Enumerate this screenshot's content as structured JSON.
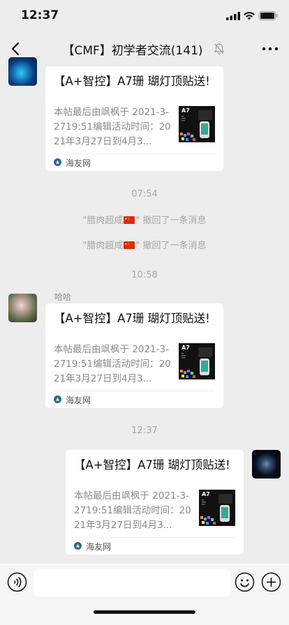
{
  "status_bar": {
    "time": "12:37"
  },
  "nav": {
    "title": "【CMF】初学者交流(141)"
  },
  "cards": [
    {
      "title": "【A+智控】A7珊 瑚灯顶贴送!",
      "description": "本帖最后由飒枫于 2021-3-2719:51编辑活动时间：2021年3月27日到4月3...",
      "thumbnail_label": "A7",
      "source": "海友网"
    },
    {
      "title": "【A+智控】A7珊 瑚灯顶贴送!",
      "description": "本帖最后由飒枫于 2021-3-2719:51编辑活动时间：2021年3月27日到4月3...",
      "thumbnail_label": "A7",
      "source": "海友网"
    },
    {
      "title": "【A+智控】A7珊 瑚灯顶贴送!",
      "description": "本帖最后由飒枫于 2021-3-2719:51编辑活动时间：2021年3月27日到4月3...",
      "thumbnail_label": "A7",
      "source": "海友网"
    }
  ],
  "timestamps": [
    "07:54",
    "10:58",
    "12:37"
  ],
  "recall": {
    "open_quote": "\"腊肉超咸",
    "rest": "\" 撤回了一条消息"
  },
  "sender": {
    "name": "哈哈"
  },
  "colors": {
    "background": "#ededed",
    "card": "#ffffff",
    "system_text": "#a6a6a6",
    "flag_red": "#de2910",
    "flag_yellow": "#ffde00"
  },
  "icons": {
    "back": "chevron-left-icon",
    "mute": "bell-off-icon",
    "more": "ellipsis-icon",
    "voice": "voice-icon",
    "emoji": "emoji-icon",
    "plus": "plus-icon",
    "source": "site-logo-icon"
  }
}
